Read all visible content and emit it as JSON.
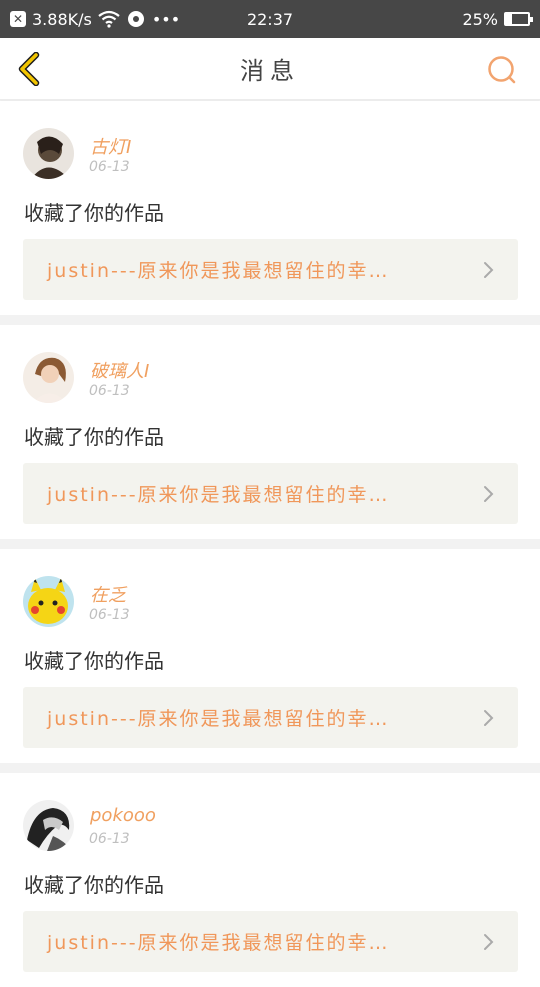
{
  "status_bar": {
    "network_speed": "3.88K/s",
    "extra_icons": "•••",
    "time": "22:37",
    "battery_percent": "25%",
    "battery_level": 0.25
  },
  "nav": {
    "title": "消息"
  },
  "feed": [
    {
      "user": "古灯I",
      "date": "06-13",
      "action": "收藏了你的作品",
      "work_title": "justin---原来你是我最想留住的幸…",
      "avatar_color": "#5a4a3a"
    },
    {
      "user": "破璃人I",
      "date": "06-13",
      "action": "收藏了你的作品",
      "work_title": "justin---原来你是我最想留住的幸…",
      "avatar_color": "#e8d8c8"
    },
    {
      "user": "在乏",
      "date": "06-13",
      "action": "收藏了你的作品",
      "work_title": "justin---原来你是我最想留住的幸…",
      "avatar_color": "#f5d515"
    },
    {
      "user": "pokooo",
      "date": "06-13",
      "action": "收藏了你的作品",
      "work_title": "justin---原来你是我最想留住的幸…",
      "avatar_color": "#3a3a3a"
    }
  ],
  "colors": {
    "accent": "#f0975a",
    "nav_back": "#f2c500",
    "search": "#f2a46f"
  }
}
